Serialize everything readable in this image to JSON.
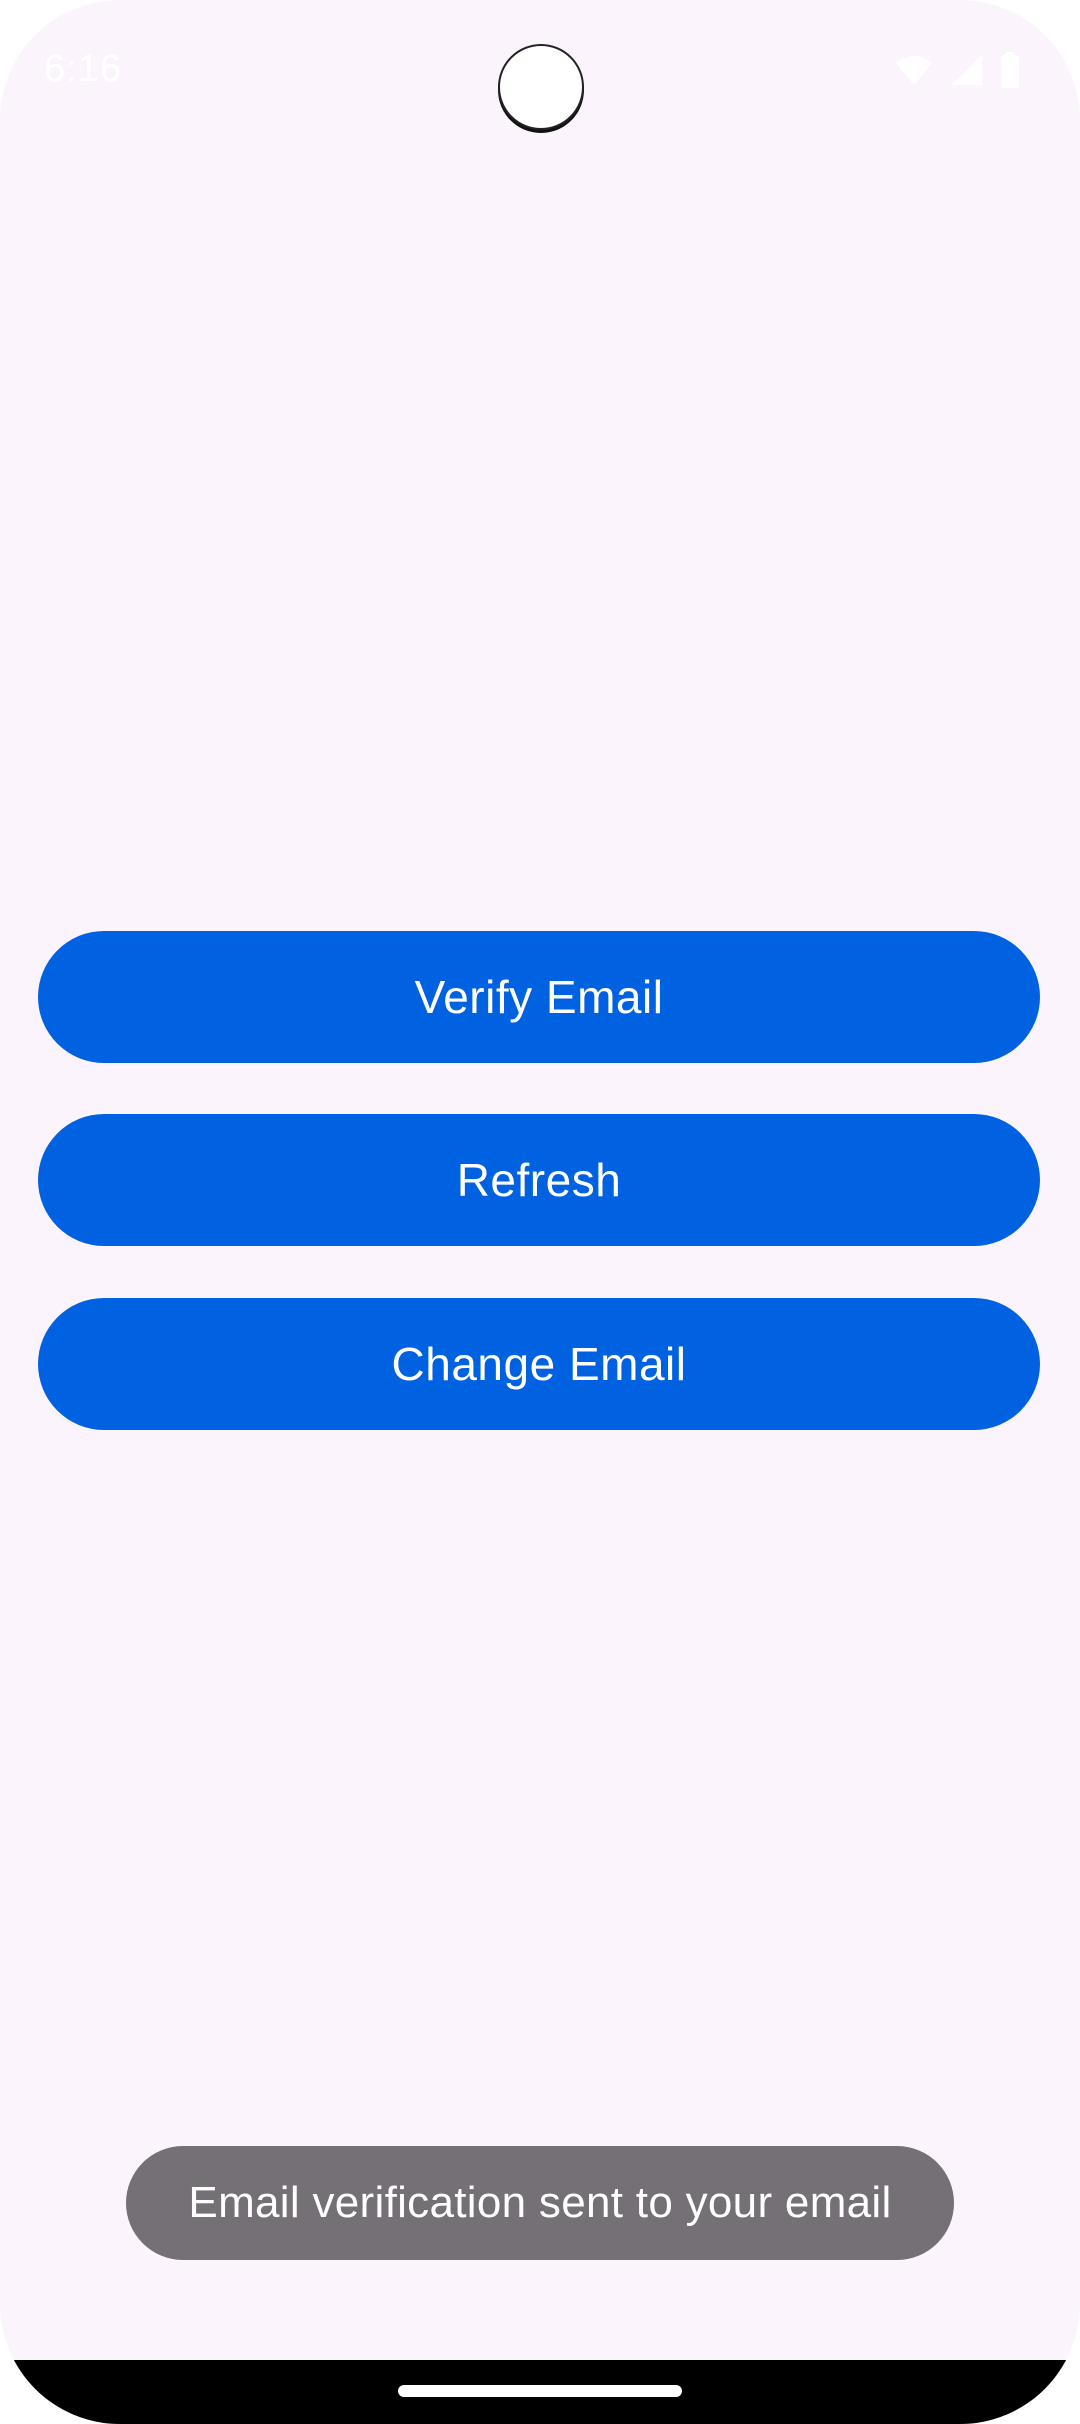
{
  "status_bar": {
    "time": "6:16",
    "icons": [
      "wifi-icon",
      "cellular-signal-icon",
      "battery-icon"
    ]
  },
  "buttons": {
    "verify_email": "Verify Email",
    "refresh": "Refresh",
    "change_email": "Change Email"
  },
  "toast": {
    "message": "Email verification sent to your email"
  },
  "colors": {
    "background": "#fcf4fc",
    "button": "#0062e0",
    "button_text": "#ffffff",
    "toast": "#757075"
  }
}
